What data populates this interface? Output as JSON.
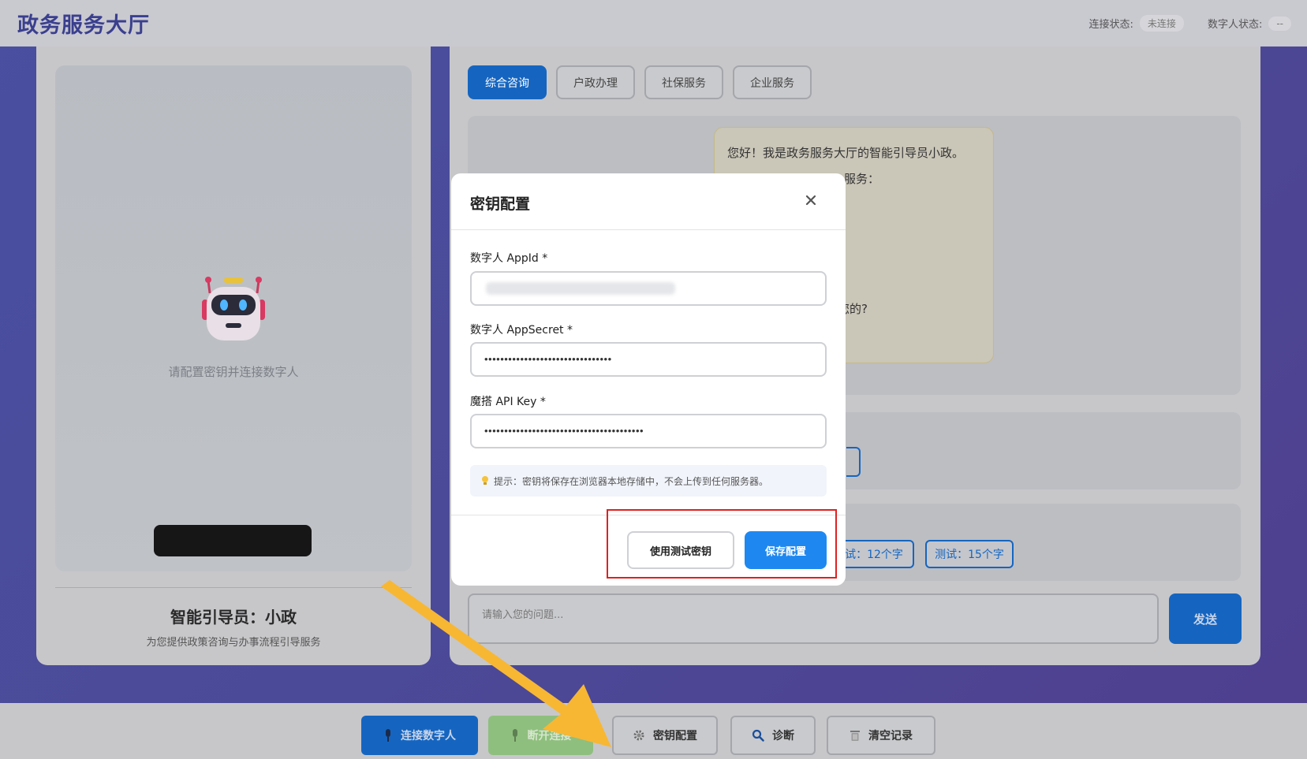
{
  "header": {
    "title": "政务服务大厅",
    "connection_label": "连接状态:",
    "connection_value": "未连接",
    "avatar_label": "数字人状态:",
    "avatar_value": "--"
  },
  "left_panel": {
    "placeholder": "请配置密钥并连接数字人",
    "guide_name": "智能引导员：小政",
    "guide_desc": "为您提供政策咨询与办事流程引导服务",
    "robot_icon": "robot-icon"
  },
  "tabs": [
    {
      "label": "综合咨询",
      "active": true
    },
    {
      "label": "户政办理",
      "active": false
    },
    {
      "label": "社保服务",
      "active": false
    },
    {
      "label": "企业服务",
      "active": false
    }
  ],
  "chat": {
    "bot_lines": [
      "您好！我是政务服务大厅的智能引导员小政。",
      "服务：",
      "",
      "",
      "",
      "",
      "您的?"
    ],
    "test_buttons": [
      "试：12个字",
      "测试：15个字"
    ],
    "input_placeholder": "请输入您的问题...",
    "send_label": "发送"
  },
  "toolbar": {
    "connect_label": "连接数字人",
    "disconnect_label": "断开连接",
    "key_config_label": "密钥配置",
    "diagnose_label": "诊断",
    "clear_label": "清空记录"
  },
  "modal": {
    "title": "密钥配置",
    "appid_label": "数字人 AppId *",
    "appid_value": "",
    "appsecret_label": "数字人 AppSecret *",
    "appsecret_value": "••••••••••••••••••••••••••••••••",
    "apikey_label": "魔搭 API Key *",
    "apikey_value": "••••••••••••••••••••••••••••••••••••••••",
    "hint": "提示：密钥将保存在浏览器本地存储中，不会上传到任何服务器。",
    "use_test_key_label": "使用测试密钥",
    "save_label": "保存配置"
  },
  "colors": {
    "primary": "#1e88f0",
    "highlight": "#e02020",
    "arrow": "#f7b733"
  }
}
